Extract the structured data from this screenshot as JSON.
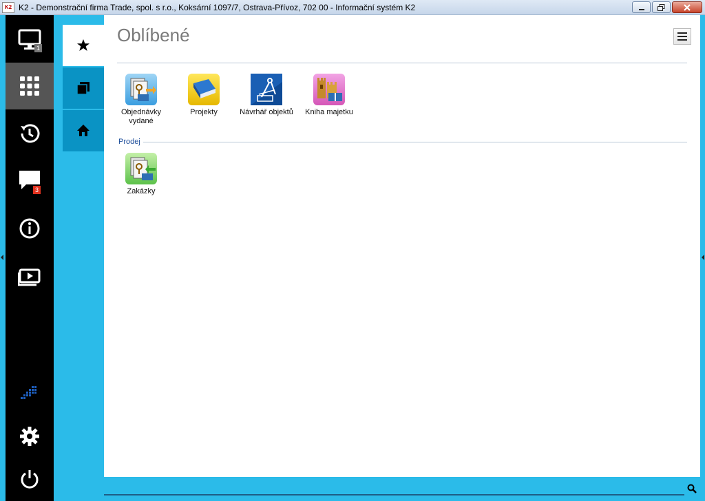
{
  "window": {
    "logo_text": "K2",
    "title": "K2 - Demonstrační firma Trade, spol. s r.o., Koksární 1097/7, Ostrava-Přívoz, 702 00 - Informační systém K2"
  },
  "sidebar": {
    "items": [
      {
        "name": "desktop",
        "icon": "monitor-icon",
        "badge": "1"
      },
      {
        "name": "apps",
        "icon": "grid-icon",
        "active": true
      },
      {
        "name": "history",
        "icon": "history-icon"
      },
      {
        "name": "messages",
        "icon": "chat-icon",
        "badge": "3"
      },
      {
        "name": "info",
        "icon": "info-icon"
      },
      {
        "name": "media",
        "icon": "media-icon"
      }
    ],
    "bottom": [
      "k2-logo-icon",
      "gear-icon",
      "power-icon"
    ]
  },
  "tabs": [
    {
      "name": "favorites",
      "icon": "star-icon",
      "active": true
    },
    {
      "name": "windows",
      "icon": "copy-icon"
    },
    {
      "name": "home",
      "icon": "home-icon"
    }
  ],
  "main": {
    "title": "Oblíbené",
    "favorites": [
      {
        "label_line1": "Objednávky",
        "label_line2": "vydané",
        "icon": "purchase-orders-icon"
      },
      {
        "label_line1": "Projekty",
        "label_line2": "",
        "icon": "book-icon"
      },
      {
        "label_line1": "Návrhář objektů",
        "label_line2": "",
        "icon": "object-designer-icon"
      },
      {
        "label_line1": "Kniha majetku",
        "label_line2": "",
        "icon": "asset-book-icon"
      }
    ],
    "section": {
      "label": "Prodej",
      "items": [
        {
          "label_line1": "Zakázky",
          "label_line2": "",
          "icon": "sales-orders-icon"
        }
      ]
    }
  },
  "colors": {
    "accent": "#2bbbe9",
    "tab_bg": "#0a93c4",
    "sidebar_bg": "#000000",
    "sidebar_active": "#555555",
    "badge_red": "#e2321f"
  }
}
